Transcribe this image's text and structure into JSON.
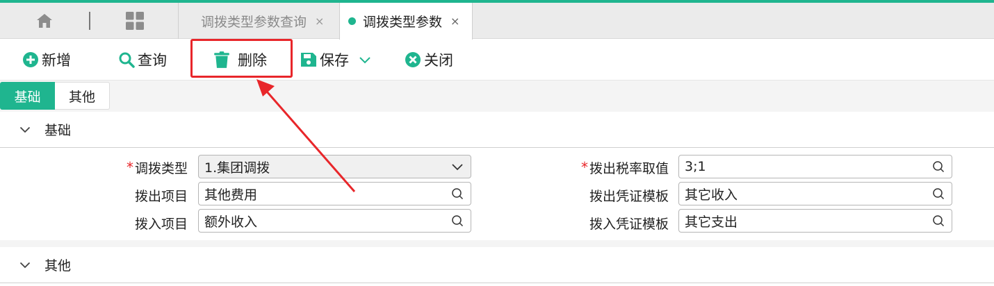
{
  "colors": {
    "accent": "#1fb58f",
    "highlight": "#e8262a"
  },
  "tabs": {
    "home_icon": "home-icon",
    "grid_icon": "grid-icon",
    "items": [
      {
        "label": "调拨类型参数查询",
        "close": "×"
      },
      {
        "label": "调拨类型参数",
        "close": "×"
      }
    ]
  },
  "toolbar": {
    "add_label": "新增",
    "query_label": "查询",
    "delete_label": "删除",
    "save_label": "保存",
    "close_label": "关闭"
  },
  "subtabs": {
    "basic": "基础",
    "other": "其他"
  },
  "sections": {
    "basic": {
      "title": "基础",
      "required_mark": "*",
      "fields": {
        "transfer_type": {
          "label": "调拨类型",
          "value": "1.集团调拨"
        },
        "out_item": {
          "label": "拨出项目",
          "value": "其他费用"
        },
        "in_item": {
          "label": "拨入项目",
          "value": "额外收入"
        },
        "out_tax": {
          "label": "拨出税率取值",
          "value": "3;1"
        },
        "out_voucher": {
          "label": "拨出凭证模板",
          "value": "其它收入"
        },
        "in_voucher": {
          "label": "拨入凭证模板",
          "value": "其它支出"
        }
      }
    },
    "other": {
      "title": "其他"
    }
  }
}
